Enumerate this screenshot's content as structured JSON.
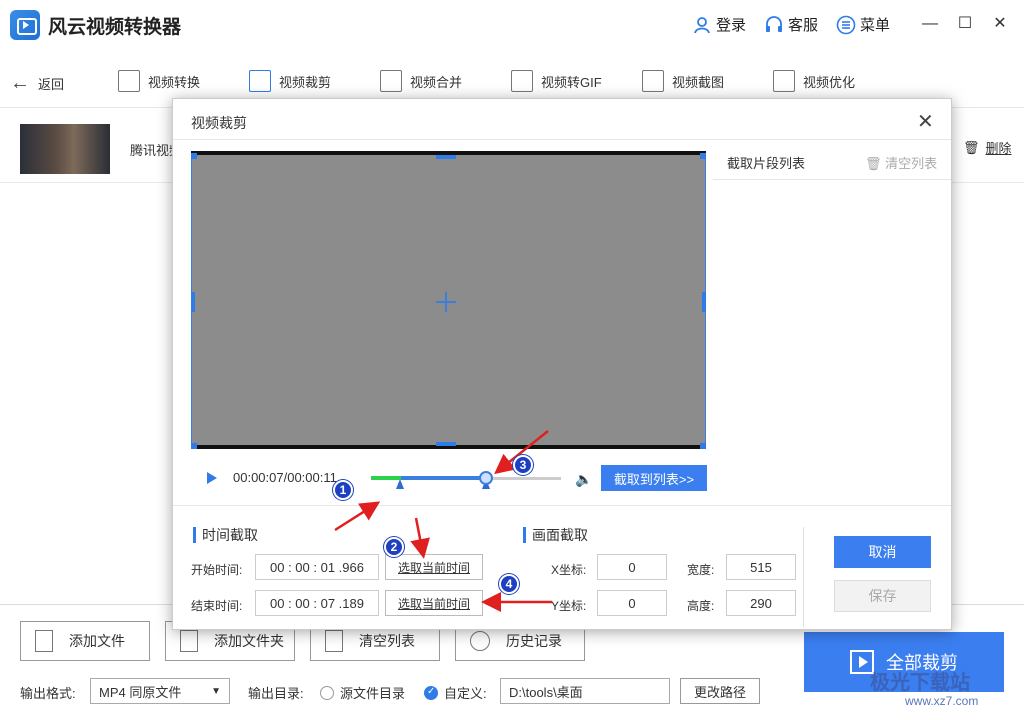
{
  "app": {
    "title": "风云视频转换器",
    "login": "登录",
    "service": "客服",
    "menu": "菜单"
  },
  "toolbar": {
    "back": "返回",
    "tools": [
      "视频转换",
      "视频裁剪",
      "视频合并",
      "视频转GIF",
      "视频截图",
      "视频优化"
    ]
  },
  "file": {
    "name": "腾讯视频",
    "delete": "删除"
  },
  "bottom": {
    "add_file": "添加文件",
    "add_folder": "添加文件夹",
    "clear_list": "清空列表",
    "history": "历史记录",
    "export_all": "全部裁剪",
    "output_format_label": "输出格式:",
    "output_format_value": "MP4 同原文件",
    "output_dir_label": "输出目录:",
    "source_dir": "源文件目录",
    "custom": "自定义:",
    "custom_path": "D:\\tools\\桌面",
    "change_path": "更改路径"
  },
  "dialog": {
    "title": "视频裁剪",
    "list_title": "截取片段列表",
    "clear_list": "清空列表",
    "timecode": "00:00:07/00:00:11",
    "add_to_list": "截取到列表>>",
    "time_section": "时间截取",
    "frame_section": "画面截取",
    "start_label": "开始时间:",
    "end_label": "结束时间:",
    "start_time": "00 : 00 : 01 .966",
    "end_time": "00 : 00 : 07 .189",
    "pick_current": "选取当前时间",
    "x_label": "X坐标:",
    "y_label": "Y坐标:",
    "w_label": "宽度:",
    "h_label": "高度:",
    "x": "0",
    "y": "0",
    "w": "515",
    "h": "290",
    "cancel": "取消",
    "save": "保存"
  },
  "annotations": [
    "1",
    "2",
    "3",
    "4"
  ],
  "watermark": {
    "text": "极光下载站",
    "url": "www.xz7.com"
  },
  "colors": {
    "accent": "#3b7ef0",
    "progress_played": "#2ed14a",
    "arrow": "#e02020",
    "badge": "#1d3fc2"
  }
}
